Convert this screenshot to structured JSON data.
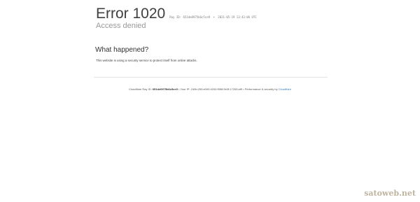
{
  "error": {
    "title": "Error 1020",
    "ray_id_label": "Ray ID:",
    "ray_id": "651de0975b6c5ce9",
    "bullet": "•",
    "timestamp": "2021-05-19 13:43:06 UTC",
    "subtitle": "Access denied"
  },
  "what_happened": {
    "heading": "What happened?",
    "text": "This website is using a security service to protect itself from online attacks."
  },
  "footer": {
    "ray_label": "Cloudflare Ray ID:",
    "ray_id": "651de0975b6c5ce9",
    "sep1": "•",
    "ip_label": "Your IP:",
    "ip": "240b:250:e000:4200:f558:5b3f:17263:af9",
    "sep2": "•",
    "perf_label": "Performance & security by",
    "perf_link": "Cloudflare"
  },
  "watermark": {
    "text": "satoweb.net"
  }
}
